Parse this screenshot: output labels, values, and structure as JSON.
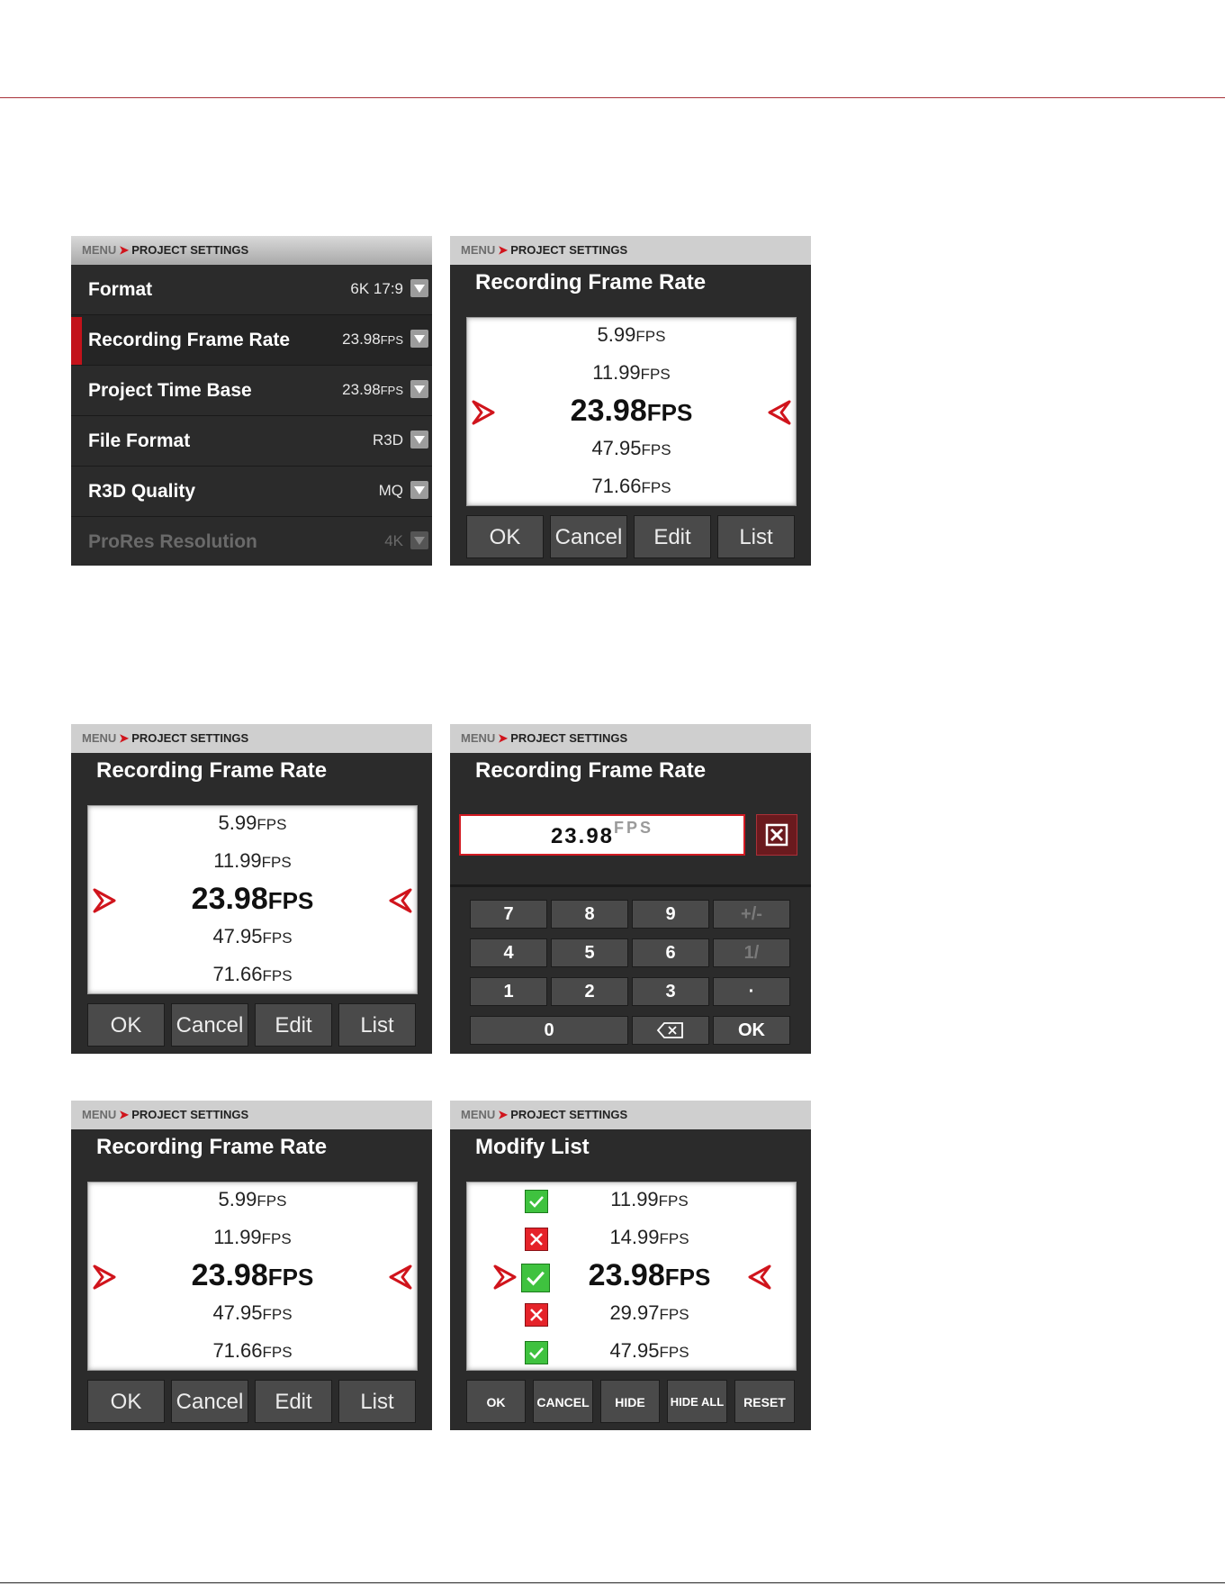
{
  "breadcrumb": {
    "menu": "MENU",
    "section": "PROJECT SETTINGS"
  },
  "settings_list": {
    "items": [
      {
        "label": "Format",
        "value": "6K 17:9",
        "unit": ""
      },
      {
        "label": "Recording Frame Rate",
        "value": "23.98",
        "unit": "FPS"
      },
      {
        "label": "Project Time Base",
        "value": "23.98",
        "unit": "FPS"
      },
      {
        "label": "File Format",
        "value": "R3D",
        "unit": ""
      },
      {
        "label": "R3D Quality",
        "value": "MQ",
        "unit": ""
      },
      {
        "label": "ProRes Resolution",
        "value": "4K",
        "unit": ""
      }
    ]
  },
  "picker": {
    "title": "Recording Frame Rate",
    "unit": "FPS",
    "options": [
      "5.99",
      "11.99",
      "23.98",
      "47.95",
      "71.66"
    ],
    "buttons": {
      "ok": "OK",
      "cancel": "Cancel",
      "edit": "Edit",
      "list": "List"
    }
  },
  "keypad": {
    "title": "Recording Frame Rate",
    "value": "23.98",
    "unit": "FPS",
    "keys": {
      "k7": "7",
      "k8": "8",
      "k9": "9",
      "sign": "+/-",
      "k4": "4",
      "k5": "5",
      "k6": "6",
      "recip": "1/",
      "k1": "1",
      "k2": "2",
      "k3": "3",
      "dot": "·",
      "k0": "0",
      "ok": "OK"
    }
  },
  "modify_list": {
    "title": "Modify List",
    "unit": "FPS",
    "rows": [
      {
        "value": "11.99",
        "checked": "on"
      },
      {
        "value": "14.99",
        "checked": "off"
      },
      {
        "value": "23.98",
        "checked": "on"
      },
      {
        "value": "29.97",
        "checked": "off"
      },
      {
        "value": "47.95",
        "checked": "on"
      }
    ],
    "buttons": {
      "ok": "OK",
      "cancel": "CANCEL",
      "hide": "HIDE",
      "hide_all": "HIDE ALL",
      "reset": "RESET"
    }
  },
  "colors": {
    "accent_red": "#d0141c",
    "panel_bg": "#2b2b2b",
    "crumb_bg": "#cfcfcf",
    "check_on": "#3fc23f",
    "check_off": "#e5232a"
  }
}
